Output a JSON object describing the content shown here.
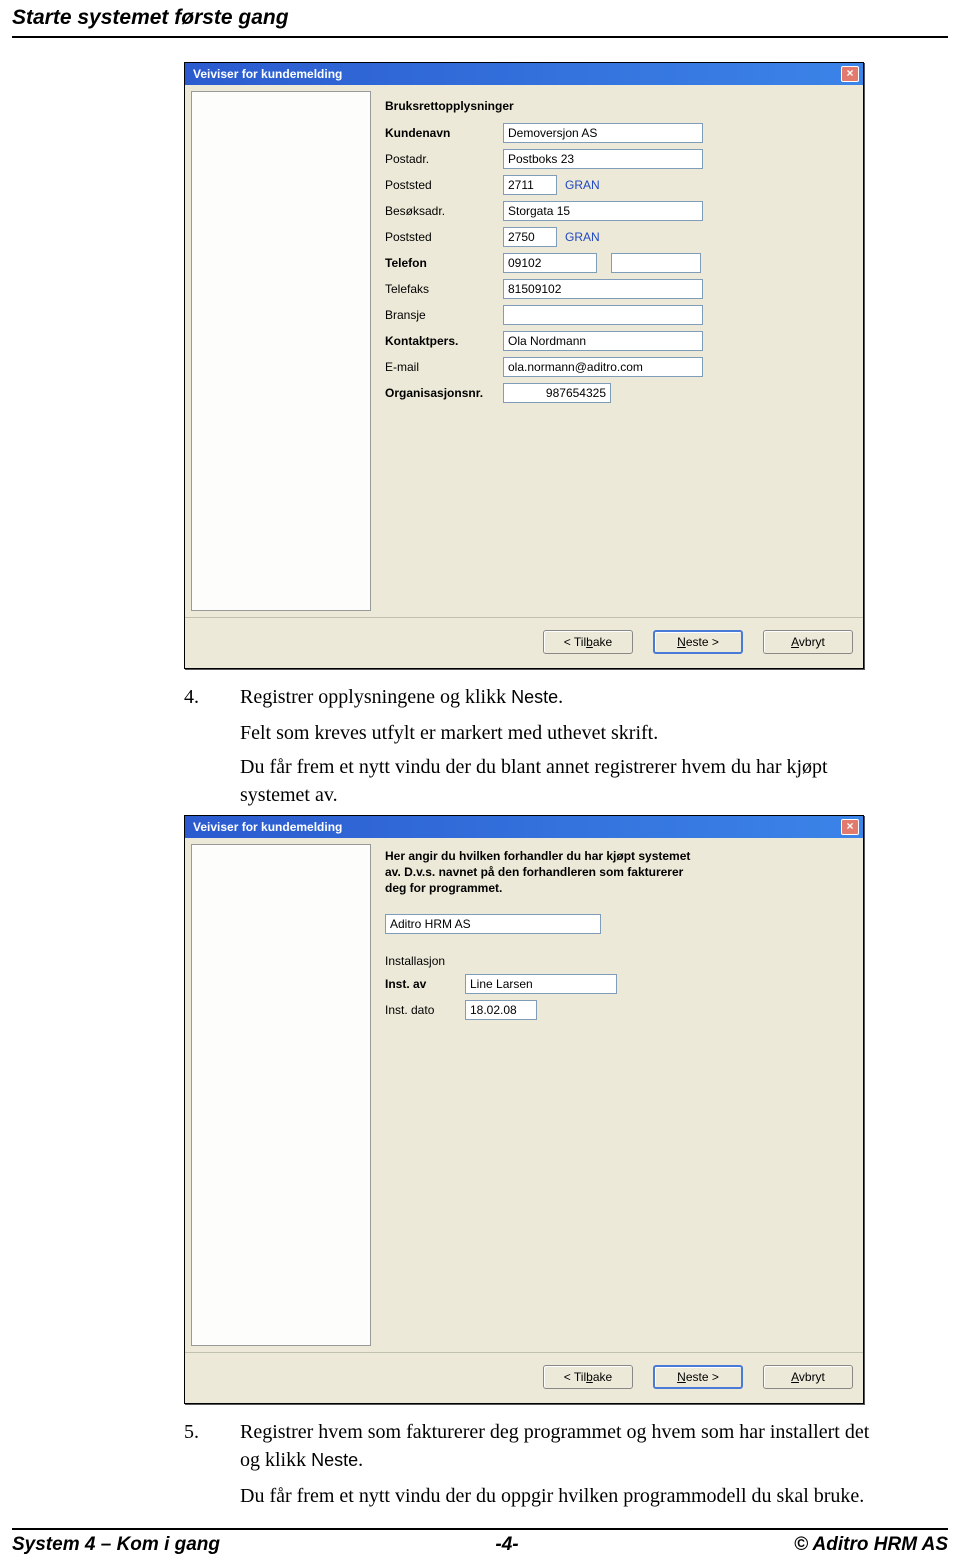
{
  "page": {
    "header": "Starte systemet første gang",
    "footer_left": "System 4 – Kom i gang",
    "footer_center": "-4-",
    "footer_right": "© Aditro HRM AS"
  },
  "dialog1": {
    "title": "Veiviser for kundemelding",
    "heading": "Bruksrettopplysninger",
    "labels": {
      "kundenavn": "Kundenavn",
      "postadr": "Postadr.",
      "poststed1": "Poststed",
      "besoksadr": "Besøksadr.",
      "poststed2": "Poststed",
      "telefon": "Telefon",
      "telefaks": "Telefaks",
      "bransje": "Bransje",
      "kontaktpers": "Kontaktpers.",
      "email": "E-mail",
      "orgnr": "Organisasjonsnr."
    },
    "values": {
      "kundenavn": "Demoversjon AS",
      "postadr": "Postboks 23",
      "postnr1": "2711",
      "poststed1": "GRAN",
      "besoksadr": "Storgata 15",
      "postnr2": "2750",
      "poststed2": "GRAN",
      "telefon": "09102",
      "telefon2": "",
      "telefaks": "81509102",
      "bransje": "",
      "kontaktpers": "Ola Nordmann",
      "email": "ola.normann@aditro.com",
      "orgnr": "987654325"
    },
    "buttons": {
      "back": "< Tilbake",
      "next": "Neste >",
      "cancel": "Avbryt"
    }
  },
  "step4": {
    "num": "4.",
    "line1a": "Registrer opplysningene og klikk ",
    "line1b": "Neste",
    "line1c": ".",
    "line2": "Felt som kreves utfylt er markert med uthevet skrift.",
    "line3": "Du får frem et nytt vindu der du blant annet registrerer hvem du har kjøpt systemet av."
  },
  "dialog2": {
    "title": "Veiviser for kundemelding",
    "info": "Her angir du hvilken forhandler du har kjøpt systemet av. D.v.s. navnet på den forhandleren som fakturerer deg for programmet.",
    "labels": {
      "forhandler": "",
      "installasjon": "Installasjon",
      "instav": "Inst. av",
      "instdato": "Inst. dato"
    },
    "values": {
      "forhandler": "Aditro HRM AS",
      "instav": "Line Larsen",
      "instdato": "18.02.08"
    },
    "buttons": {
      "back": "< Tilbake",
      "next": "Neste >",
      "cancel": "Avbryt"
    }
  },
  "step5": {
    "num": "5.",
    "line1a": "Registrer hvem som fakturerer deg programmet og hvem som har installert det og klikk ",
    "line1b": "Neste",
    "line1c": ".",
    "line2": "Du får frem et nytt vindu der du oppgir hvilken programmodell du skal bruke."
  }
}
